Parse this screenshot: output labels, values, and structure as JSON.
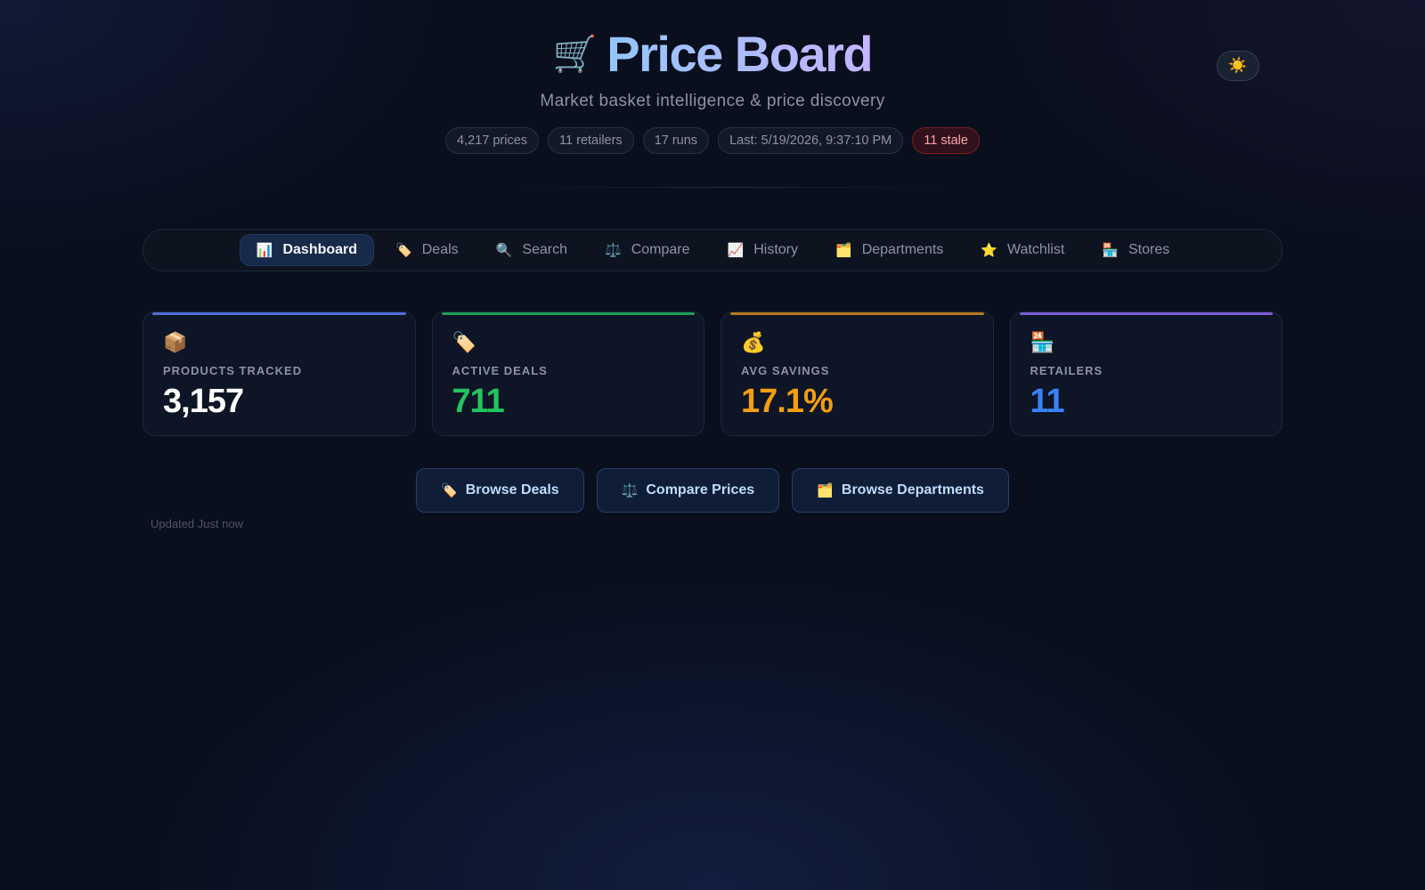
{
  "header": {
    "cart_icon": "🛒",
    "title": "Price Board",
    "subtitle": "Market basket intelligence & price discovery",
    "pills": [
      "4,217 prices",
      "11 retailers",
      "17 runs",
      "Last: 5/19/2026, 9:37:10 PM"
    ],
    "stale_pill": "11 stale"
  },
  "theme_toggle": {
    "icon": "☀️"
  },
  "nav": {
    "tabs": [
      {
        "icon": "📊",
        "label": "Dashboard"
      },
      {
        "icon": "🏷️",
        "label": "Deals"
      },
      {
        "icon": "🔍",
        "label": "Search"
      },
      {
        "icon": "⚖️",
        "label": "Compare"
      },
      {
        "icon": "📈",
        "label": "History"
      },
      {
        "icon": "🗂️",
        "label": "Departments"
      },
      {
        "icon": "⭐",
        "label": "Watchlist"
      },
      {
        "icon": "🏪",
        "label": "Stores"
      }
    ]
  },
  "stats": [
    {
      "icon": "📦",
      "label": "PRODUCTS TRACKED",
      "value": "3,157",
      "color": "#ffffff",
      "accent": "#4f6fd8"
    },
    {
      "icon": "🏷️",
      "label": "ACTIVE DEALS",
      "value": "711",
      "color": "#22c55e",
      "accent": "#1f9d55"
    },
    {
      "icon": "💰",
      "label": "AVG SAVINGS",
      "value": "17.1%",
      "color": "#f59e0b",
      "accent": "#b7791f"
    },
    {
      "icon": "🏪",
      "label": "RETAILERS",
      "value": "11",
      "color": "#3b82f6",
      "accent": "#7c5cd6"
    }
  ],
  "actions": [
    {
      "icon": "🏷️",
      "label": "Browse Deals"
    },
    {
      "icon": "⚖️",
      "label": "Compare Prices"
    },
    {
      "icon": "🗂️",
      "label": "Browse Departments"
    }
  ],
  "updated_text": "Updated Just now"
}
